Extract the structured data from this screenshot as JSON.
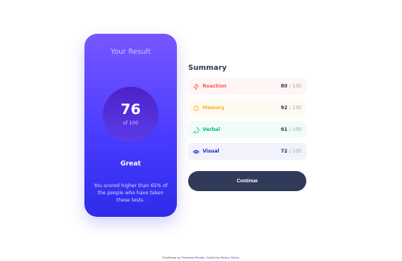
{
  "result": {
    "title": "Your Result",
    "score": "76",
    "of_label": "of 100",
    "verdict": "Great",
    "description": "You scored higher than 65% of the people who have taken these tests."
  },
  "summary": {
    "title": "Summary",
    "items": [
      {
        "label": "Reaction",
        "score": "80",
        "max": "100",
        "icon": "lightning-icon",
        "color": "#ff5757"
      },
      {
        "label": "Memory",
        "score": "92",
        "max": "100",
        "icon": "brain-icon",
        "color": "#ffb01f"
      },
      {
        "label": "Verbal",
        "score": "61",
        "max": "100",
        "icon": "speech-bubble-icon",
        "color": "#00bb8f"
      },
      {
        "label": "Visual",
        "score": "72",
        "max": "100",
        "icon": "eye-icon",
        "color": "#1125d4"
      }
    ]
  },
  "continue_label": "Continue",
  "attribution": {
    "prefix": "Challenge by",
    "fm_link": "Frontend Mentor",
    "middle": ". Coded by",
    "author_link": "Melisa Olinta",
    "suffix": "."
  }
}
